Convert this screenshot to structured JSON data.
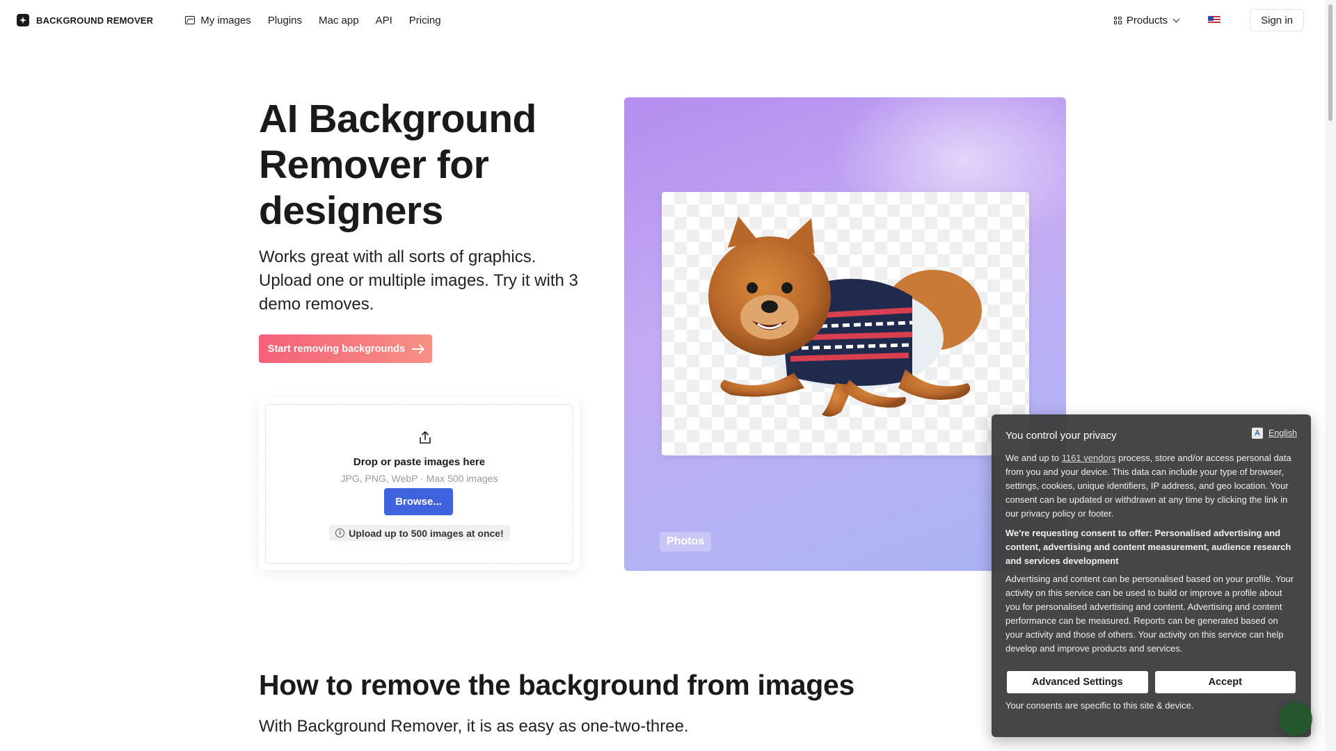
{
  "header": {
    "logo_text": "BACKGROUND REMOVER",
    "nav": [
      "My images",
      "Plugins",
      "Mac app",
      "API",
      "Pricing"
    ],
    "products_label": "Products",
    "signin_label": "Sign in"
  },
  "hero": {
    "title": "AI Background Remover for designers",
    "subtitle": "Works great with all sorts of graphics. Upload one or multiple images. Try it with 3 demo removes.",
    "cta_label": "Start removing backgrounds"
  },
  "upload": {
    "title": "Drop or paste images here",
    "hint": "JPG, PNG, WebP · Max 500 images",
    "browse_label": "Browse...",
    "note": "Upload up to 500 images at once!"
  },
  "showcase": {
    "tag": "Photos"
  },
  "how_to": {
    "title": "How to remove the background from images",
    "subtitle": "With Background Remover, it is as easy as one-two-three."
  },
  "consent": {
    "title": "You control your privacy",
    "language": "English",
    "p1_before": "We and up to ",
    "vendors_link": "1161 vendors",
    "p1_after": " process, store and/or access personal data from you and your device. This data can include your type of browser, settings, cookies, unique identifiers, IP address, and geo location. Your consent can be updated or withdrawn at any time by clicking the link in our privacy policy or footer.",
    "purposes": "We're requesting consent to offer: Personalised advertising and content, advertising and content measurement, audience research and services development",
    "details": "Advertising and content can be personalised based on your profile. Your activity on this service can be used to build or improve a profile about you for personalised advertising and content. Advertising and content performance can be measured. Reports can be generated based on your activity and those of others. Your activity on this service can help develop and improve products and services.",
    "advanced_label": "Advanced Settings",
    "accept_label": "Accept",
    "footer": "Your consents are specific to this site & device."
  },
  "colors": {
    "cta_start": "#f6607a",
    "cta_end": "#f69184",
    "browse": "#3f63dc",
    "showcase_start": "#b48ef0",
    "showcase_end": "#a9b4f5",
    "consent_bg": "#3e3e3e"
  },
  "icons": {
    "logo": "sparkle-logo-icon",
    "my_images": "image-icon",
    "products": "grid-icon",
    "language": "us-flag-icon",
    "cta": "arrow-right-icon",
    "upload": "upload-icon",
    "info": "info-icon",
    "translate": "translate-icon"
  }
}
